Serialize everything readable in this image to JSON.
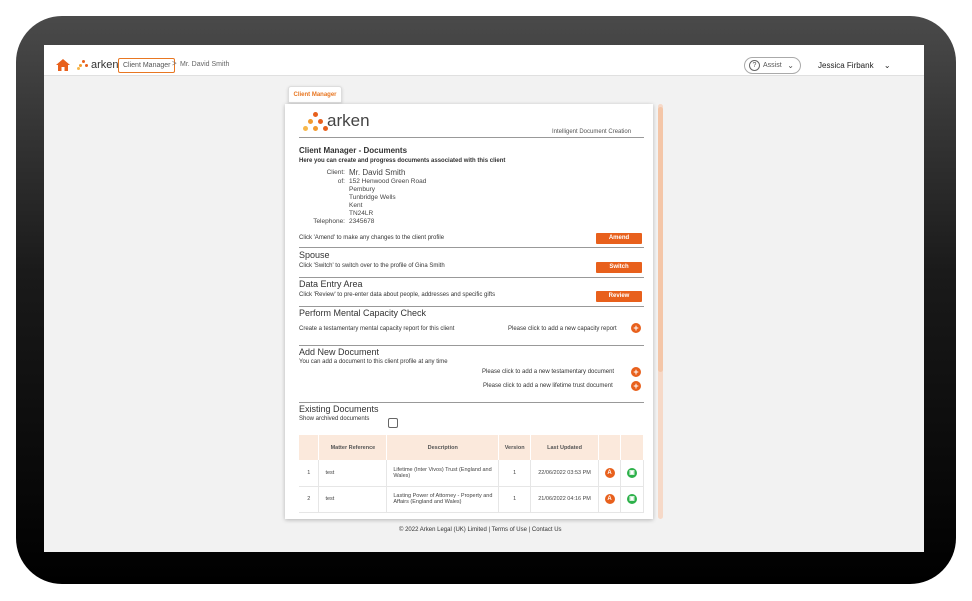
{
  "topbar": {
    "logo_text": "arken",
    "breadcrumb_button": "Client Manager",
    "breadcrumb_sep": ">",
    "breadcrumb_current": "Mr. David Smith",
    "assist_label": "Assist",
    "assist_q": "?",
    "user_name": "Jessica Firbank"
  },
  "tab": {
    "label": "Client Manager"
  },
  "panel": {
    "logo_text": "arken",
    "tagline": "Intelligent Document Creation",
    "title": "Client Manager - Documents",
    "intro": "Here you can create and progress documents associated with this client",
    "client": {
      "client_label": "Client:",
      "client_name": "Mr. David Smith",
      "of_label": "of:",
      "address": [
        "152 Henwood Green Road",
        "Pembury",
        "Tunbridge Wells",
        "Kent",
        "TN24LR"
      ],
      "telephone_label": "Telephone:",
      "telephone": "2345678"
    },
    "amend": {
      "desc": "Click 'Amend' to make any changes to the client profile",
      "button": "Amend"
    },
    "spouse": {
      "title": "Spouse",
      "desc": "Click 'Switch' to switch over to the profile of Gina Smith",
      "button": "Switch"
    },
    "data_entry": {
      "title": "Data Entry Area",
      "desc": "Click 'Review' to pre-enter data about people, addresses and specific gifts",
      "button": "Review"
    },
    "capacity": {
      "title": "Perform Mental Capacity Check",
      "desc": "Create a testamentary mental capacity report for this client",
      "link": "Please click to add a new capacity report"
    },
    "add_doc": {
      "title": "Add New Document",
      "desc": "You can add a document to this client profile at any time",
      "link_testamentary": "Please click to add a new testamentary document",
      "link_lifetime": "Please click to add a new lifetime trust document"
    },
    "existing": {
      "title": "Existing Documents",
      "show_archived": "Show archived documents",
      "headers": [
        "",
        "Matter Reference",
        "Description",
        "Version",
        "Last Updated",
        "",
        ""
      ],
      "rows": [
        {
          "num": "1",
          "ref": "test",
          "desc": "Lifetime (Inter Vivos) Trust (England and Wales)",
          "version": "1",
          "updated": "22/06/2022 03:53 PM"
        },
        {
          "num": "2",
          "ref": "test",
          "desc": "Lasting Power of Attorney - Property and Affairs (England and Wales)",
          "version": "1",
          "updated": "21/06/2022 04:16 PM"
        }
      ],
      "action_a": "A",
      "action_lock": "🔒"
    },
    "plus": "+"
  },
  "footer": {
    "copyright": "© 2022 Arken Legal (UK) Limited",
    "sep1": " | ",
    "terms": "Terms of Use",
    "sep2": " | ",
    "contact": "Contact Us"
  },
  "colors": {
    "accent": "#e8601c",
    "lock_green": "#2db14a",
    "header_tint": "#fbe9dc"
  },
  "icons": [
    "home-icon",
    "arken-logo-icon",
    "question-icon",
    "chevron-down-icon",
    "plus-circle-icon",
    "amend-icon",
    "lock-icon"
  ]
}
